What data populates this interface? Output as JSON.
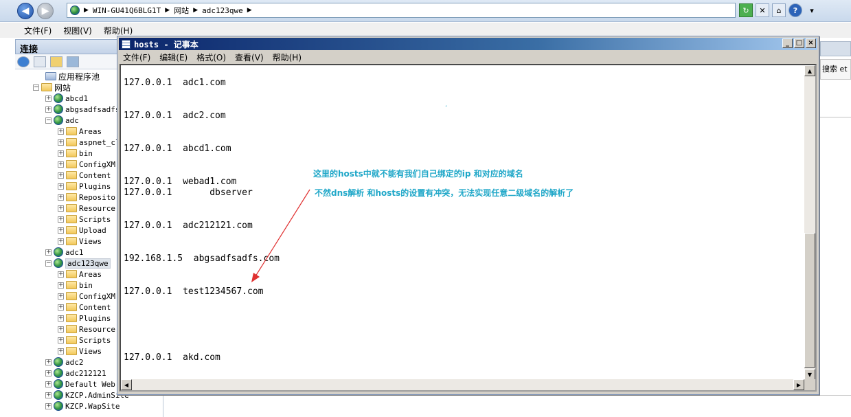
{
  "iis": {
    "address": {
      "segments": [
        "WIN-GU41Q6BLG1T",
        "网站",
        "adc123qwe"
      ]
    },
    "menu": [
      "文件(F)",
      "视图(V)",
      "帮助(H)"
    ],
    "connections_title": "连接",
    "tree": {
      "app_pools": "应用程序池",
      "sites": "网站",
      "items": [
        {
          "label": "abcd1",
          "type": "site"
        },
        {
          "label": "abgsadfsadfs",
          "type": "site"
        },
        {
          "label": "adc",
          "type": "site"
        },
        {
          "label": "Areas",
          "type": "folder"
        },
        {
          "label": "aspnet_cl",
          "type": "folder"
        },
        {
          "label": "bin",
          "type": "folder"
        },
        {
          "label": "ConfigXM",
          "type": "folder"
        },
        {
          "label": "Content",
          "type": "folder"
        },
        {
          "label": "Plugins",
          "type": "folder"
        },
        {
          "label": "Reposito",
          "type": "folder"
        },
        {
          "label": "Resource",
          "type": "folder"
        },
        {
          "label": "Scripts",
          "type": "folder"
        },
        {
          "label": "Upload",
          "type": "folder"
        },
        {
          "label": "Views",
          "type": "folder"
        },
        {
          "label": "adc1",
          "type": "site"
        },
        {
          "label": "adc123qwe",
          "type": "site"
        },
        {
          "label": "Areas",
          "type": "folder"
        },
        {
          "label": "bin",
          "type": "folder"
        },
        {
          "label": "ConfigXM",
          "type": "folder"
        },
        {
          "label": "Content",
          "type": "folder"
        },
        {
          "label": "Plugins",
          "type": "folder"
        },
        {
          "label": "Resource",
          "type": "folder"
        },
        {
          "label": "Scripts",
          "type": "folder"
        },
        {
          "label": "Views",
          "type": "folder"
        },
        {
          "label": "adc2",
          "type": "site"
        },
        {
          "label": "adc212121",
          "type": "site"
        },
        {
          "label": "Default Web Site",
          "type": "site"
        },
        {
          "label": "KZCP.AdminSite",
          "type": "site"
        },
        {
          "label": "KZCP.WapSite",
          "type": "site"
        }
      ]
    },
    "search_label": "搜索 et"
  },
  "notepad": {
    "title": "hosts - 记事本",
    "menu": [
      "文件(F)",
      "编辑(E)",
      "格式(O)",
      "查看(V)",
      "帮助(H)"
    ],
    "lines": [
      "127.0.0.1  adc1.com",
      "127.0.0.1  adc2.com",
      "127.0.0.1  abcd1.com",
      "127.0.0.1  webad1.com",
      "127.0.0.1       dbserver",
      "127.0.0.1  adc212121.com",
      "192.168.1.5  abgsadfsadfs.com",
      "127.0.0.1  test1234567.com",
      "127.0.0.1  akd.com"
    ]
  },
  "annotation": {
    "line1": "这里的hosts中就不能有我们自己绑定的ip 和对应的域名",
    "line2": "不然dns解析 和hosts的设置有冲突，无法实现任意二级域名的解析了",
    "color": "#1fa7c8",
    "arrow_color": "#e03030"
  }
}
